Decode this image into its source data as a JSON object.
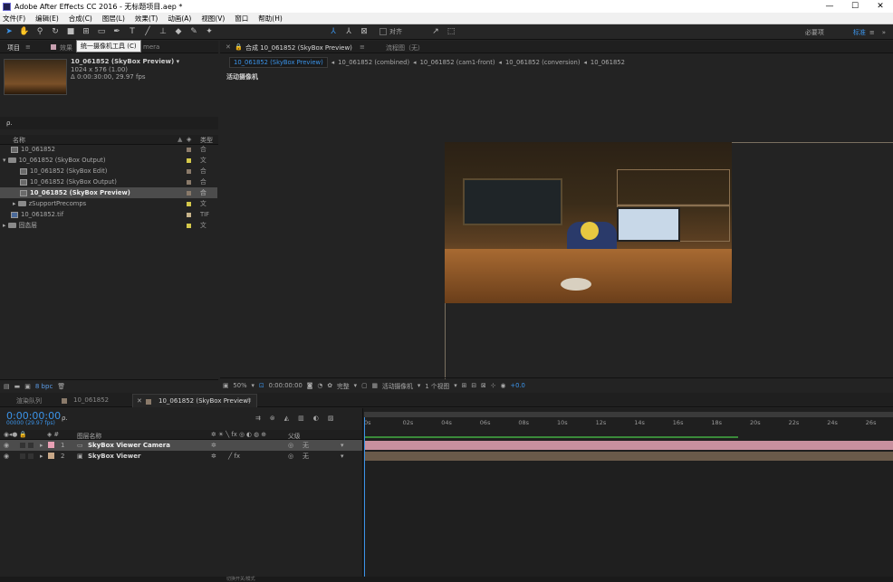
{
  "window": {
    "title": "Adobe After Effects CC 2016 - 无标题项目.aep *",
    "min": "—",
    "max": "☐",
    "close": "✕"
  },
  "menu": [
    "文件(F)",
    "编辑(E)",
    "合成(C)",
    "图层(L)",
    "效果(T)",
    "动画(A)",
    "视图(V)",
    "窗口",
    "帮助(H)"
  ],
  "toolbar": {
    "tooltip": "统一摄像机工具 (C)",
    "align_label": "对齐",
    "workspaces": [
      "必要项",
      "标准"
    ],
    "active_workspace": "标准",
    "more": "»"
  },
  "project": {
    "tab_label": "项目",
    "tab2_label": "效果",
    "tab3_partial": "mera",
    "thumb_name": "10_061852 (SkyBox Preview) ▾",
    "thumb_size": "1024 x 576 (1.00)",
    "thumb_duration": "Δ 0:00:30:00, 29.97 fps",
    "search_placeholder": "ρ.",
    "col_name": "名称",
    "col_type": "类型",
    "items": [
      {
        "name": "10_061852",
        "type": "合",
        "indent": 0,
        "icon": "comp",
        "color": "#8a7a6a"
      },
      {
        "name": "10_061852 (SkyBox Output)",
        "type": "文",
        "indent": 0,
        "icon": "folder-open",
        "color": "#d4c84a"
      },
      {
        "name": "10_061852 (SkyBox Edit)",
        "type": "合",
        "indent": 1,
        "icon": "comp",
        "color": "#8a7a6a"
      },
      {
        "name": "10_061852 (SkyBox Output)",
        "type": "合",
        "indent": 1,
        "icon": "comp",
        "color": "#8a7a6a"
      },
      {
        "name": "10_061852 (SkyBox Preview)",
        "type": "合",
        "indent": 1,
        "icon": "comp",
        "color": "#8a7a6a",
        "selected": true
      },
      {
        "name": "zSupportPrecomps",
        "type": "文",
        "indent": 1,
        "icon": "folder",
        "color": "#d4c84a"
      },
      {
        "name": "10_061852.tif",
        "type": "TIF",
        "indent": 0,
        "icon": "file",
        "color": "#c8b48a"
      },
      {
        "name": "固态层",
        "type": "文",
        "indent": 0,
        "icon": "folder",
        "color": "#d4c84a"
      }
    ],
    "bpc": "8 bpc"
  },
  "comp": {
    "tab_label": "合成 10_061852 (SkyBox Preview)",
    "tab2_label": "流程图（无）",
    "breadcrumbs": [
      "10_061852 (SkyBox Preview)",
      "10_061852 (combined)",
      "10_061852 (cam1-front)",
      "10_061852 (conversion)",
      "10_061852"
    ],
    "camera_label": "活动摄像机",
    "zoom": "50%",
    "timecode": "0:00:00:00",
    "quality": "完整",
    "camera_select": "活动摄像机",
    "views": "1 个视图",
    "exposure": "+0.0"
  },
  "timeline": {
    "tabs": [
      "渲染队列",
      "10_061852",
      "10_061852 (SkyBox Preview)"
    ],
    "timecode": "0:00:00:00",
    "frame_info": "00000 (29.97 fps)",
    "col_layer_name": "图层名称",
    "col_parent": "父级",
    "layers": [
      {
        "num": "1",
        "name": "SkyBox Viewer Camera",
        "parent": "无",
        "color": "#e8a0b4",
        "selected": true
      },
      {
        "num": "2",
        "name": "SkyBox Viewer",
        "parent": "无",
        "color": "#c8a888"
      }
    ],
    "ruler": [
      "0s",
      "02s",
      "04s",
      "06s",
      "08s",
      "10s",
      "12s",
      "14s",
      "16s",
      "18s",
      "20s",
      "22s",
      "24s",
      "26s"
    ],
    "footer": "切换开关/模式"
  }
}
